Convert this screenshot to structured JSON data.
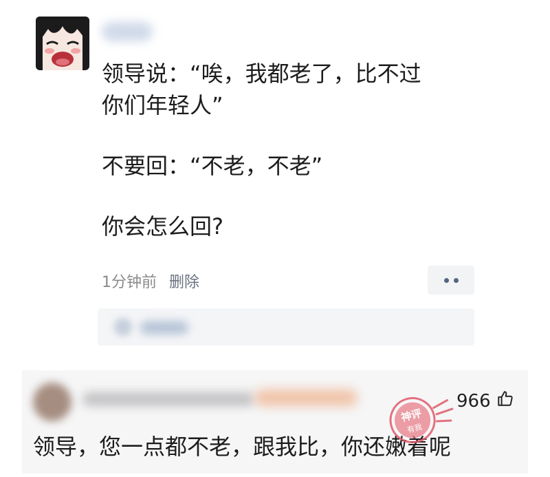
{
  "post": {
    "lines": [
      "领导说：“唉，我都老了，比不过",
      "你们年轻人”",
      "不要回：“不老，不老”",
      "你会怎么回?"
    ],
    "time": "1分钟前",
    "delete_label": "删除",
    "more_icon": "more-dots-icon"
  },
  "reply": {
    "likes": "966",
    "text": "领导，您一点都不老，跟我比，你还嫩着呢",
    "like_icon": "thumbs-up-icon"
  },
  "watermark": {
    "text1": "神评",
    "text2": "有我"
  },
  "colors": {
    "stamp": "#e05a6a",
    "more_dots": "#55657d",
    "meta": "#8a8a8a"
  }
}
